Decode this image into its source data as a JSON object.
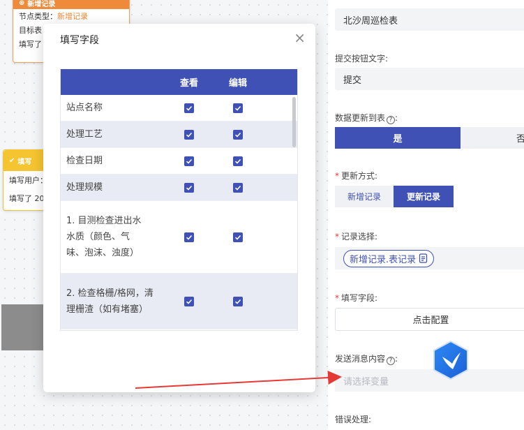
{
  "canvas": {
    "node_add": {
      "title": "新增记录",
      "row1_label": "节点类型：",
      "row1_value": "新增记录",
      "row2": "目标表：",
      "row3": "填写了"
    },
    "node_fill": {
      "title": "填写",
      "row1": "填写用户：",
      "row2": "填写了 20"
    }
  },
  "modal": {
    "title": "填写字段",
    "close_glyph": "×",
    "columns": {
      "name": "",
      "view": "查看",
      "edit": "编辑"
    },
    "rows": [
      {
        "name": "站点名称",
        "view": true,
        "edit": true
      },
      {
        "name": "处理工艺",
        "view": true,
        "edit": true
      },
      {
        "name": "检查日期",
        "view": true,
        "edit": true
      },
      {
        "name": "处理规模",
        "view": true,
        "edit": true
      },
      {
        "name": "1. 目测检查进出水水质（颜色、气味、泡沫、浊度）",
        "view": true,
        "edit": true
      },
      {
        "name": "2. 检查格栅/格网，清理栅渣（如有堵塞）",
        "view": true,
        "edit": true
      }
    ]
  },
  "panel": {
    "table_name": "北沙周巡检表",
    "submit_label": "提交按钮文字:",
    "submit_value": "提交",
    "update_to_table_label": "数据更新到表",
    "help_glyph": "?",
    "yes": "是",
    "no": "否",
    "update_mode_label": "更新方式:",
    "mode_new": "新增记录",
    "mode_update": "更新记录",
    "record_select_label": "记录选择:",
    "record_pill": "新增记录.表记录",
    "fill_fields_label": "填写字段:",
    "config_button": "点击配置",
    "send_msg_label": "发送消息内容",
    "var_placeholder": "请选择变量",
    "error_label": "错误处理:"
  },
  "colors": {
    "primary": "#3f51b5",
    "orange": "#ef8a3a",
    "yellow": "#f5c531",
    "required": "#e53935",
    "arrow": "#e53935"
  }
}
